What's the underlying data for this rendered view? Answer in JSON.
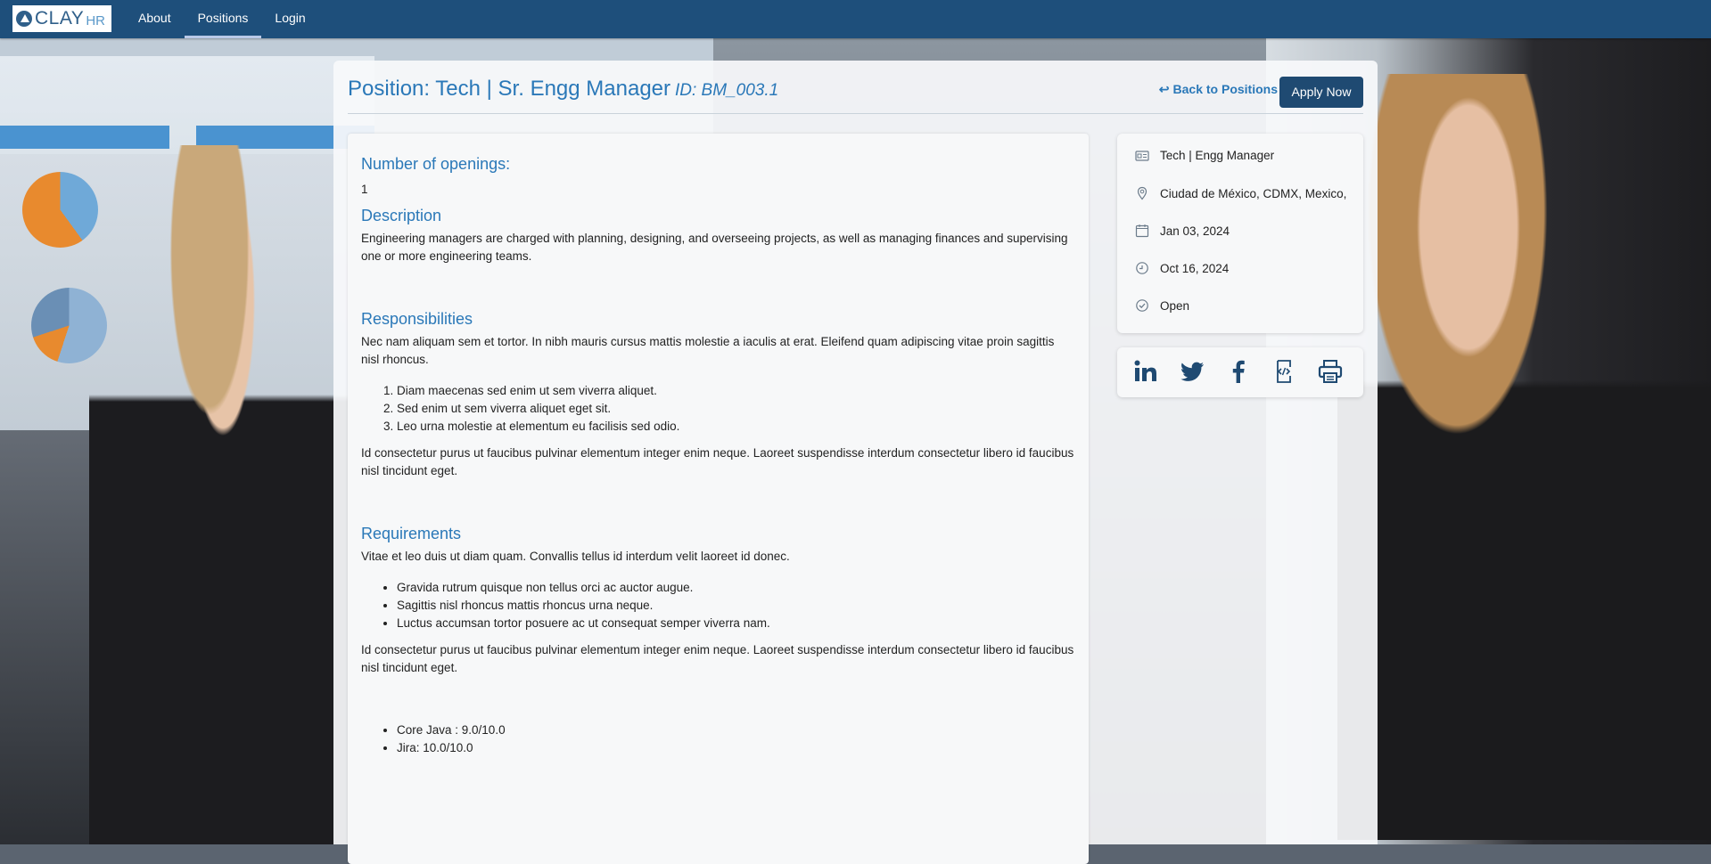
{
  "brand": {
    "name": "CLAY",
    "suffix": "HR"
  },
  "nav": {
    "items": [
      {
        "label": "About"
      },
      {
        "label": "Positions"
      },
      {
        "label": "Login"
      }
    ]
  },
  "position": {
    "title": "Position: Tech | Sr. Engg Manager",
    "id": "ID: BM_003.1",
    "back_label": "Back to Positions",
    "apply_label": "Apply Now"
  },
  "details": {
    "openings_heading": "Number of openings:",
    "openings_value": "1",
    "description_heading": "Description",
    "description_text": "Engineering managers are charged with planning, designing, and overseeing projects, as well as managing finances and supervising one or more engineering teams.",
    "responsibilities_heading": "Responsibilities",
    "responsibilities_intro": "Nec nam aliquam sem et tortor. In nibh mauris cursus mattis molestie a iaculis at erat. Eleifend quam adipiscing vitae proin sagittis nisl rhoncus.",
    "responsibilities_list": [
      "Diam maecenas sed enim ut sem viverra aliquet.",
      "Sed enim ut sem viverra aliquet eget sit.",
      "Leo urna molestie at elementum eu facilisis sed odio."
    ],
    "responsibilities_outro": "Id consectetur purus ut faucibus pulvinar elementum integer enim neque. Laoreet suspendisse interdum consectetur libero id faucibus nisl tincidunt eget.",
    "requirements_heading": "Requirements",
    "requirements_intro": "Vitae et leo duis ut diam quam. Convallis tellus id interdum velit laoreet id donec.",
    "requirements_list": [
      "Gravida rutrum quisque non tellus orci ac auctor augue.",
      "Sagittis nisl rhoncus mattis rhoncus urna neque.",
      "Luctus accumsan tortor posuere ac ut consequat semper viverra nam."
    ],
    "requirements_outro": "Id consectetur purus ut faucibus pulvinar elementum integer enim neque. Laoreet suspendisse interdum consectetur libero id faucibus nisl tincidunt eget.",
    "skills": [
      "Core Java : 9.0/10.0",
      "Jira: 10.0/10.0"
    ]
  },
  "summary": {
    "department": "Tech | Engg Manager",
    "location": "Ciudad de México, CDMX, Mexico,",
    "start_date": "Jan 03, 2024",
    "end_date": "Oct 16, 2024",
    "status": "Open"
  },
  "share_icons": [
    "linkedin-icon",
    "twitter-icon",
    "facebook-icon",
    "embed-code-icon",
    "print-icon"
  ],
  "colors": {
    "navbar": "#1e4f7b",
    "accent": "#2a78b8",
    "apply_button": "#1f4a72"
  }
}
